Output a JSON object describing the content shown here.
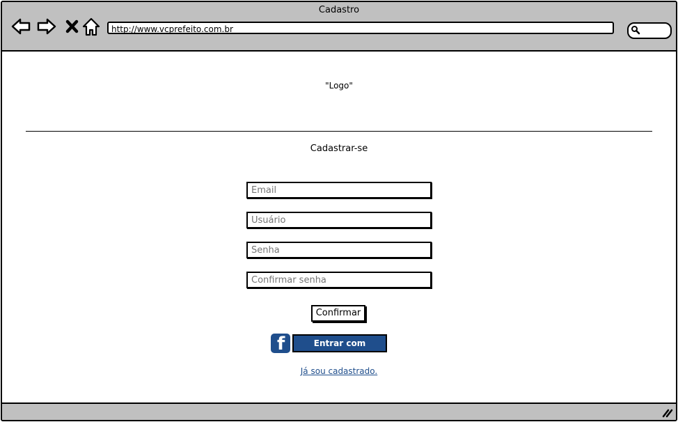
{
  "window": {
    "title": "Cadastro",
    "url": "http://www.vcprefeito.com.br"
  },
  "icons": {
    "back": "back-arrow-icon",
    "forward": "forward-arrow-icon",
    "close": "close-icon",
    "home": "home-icon",
    "search": "search-icon",
    "resize": "resize-grip-icon",
    "facebook": "facebook-icon"
  },
  "page": {
    "logo": "\"Logo\"",
    "heading": "Cadastrar-se"
  },
  "form": {
    "email_placeholder": "Email",
    "username_placeholder": "Usuário",
    "password_placeholder": "Senha",
    "confirm_password_placeholder": "Confirmar senha",
    "confirm_label": "Confirmar",
    "facebook_label": "Entrar com facebook",
    "already_registered": "Já sou cadastrado."
  },
  "colors": {
    "chrome": "#c0c0c0",
    "facebook": "#1f4e8c",
    "link": "#1f4e8c"
  }
}
